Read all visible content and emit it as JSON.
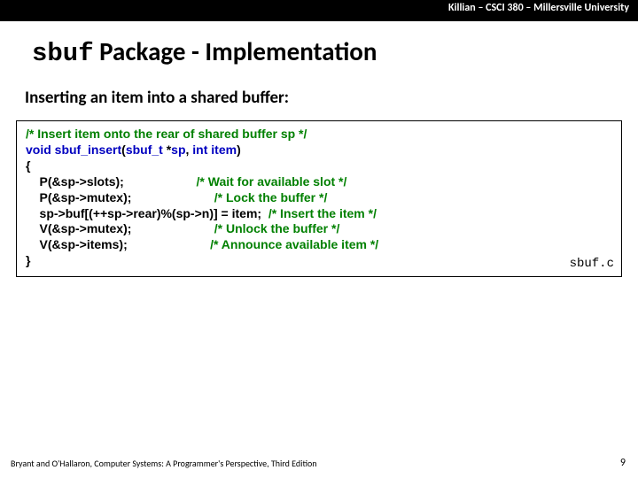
{
  "header": {
    "text": "Killian – CSCI 380 – Millersville University"
  },
  "title": {
    "mono": "sbuf",
    "rest": " Package - Implementation"
  },
  "subhead": "Inserting an item into a shared buffer:",
  "code": {
    "l01_comment": "/* Insert item onto the rear of shared buffer sp */",
    "l02_kw_void": "void",
    "l02_name": " sbuf_insert",
    "l02_paren_open": "(",
    "l02_type": "sbuf_t",
    "l02_star_sp": " *",
    "l02_var_sp": "sp",
    "l02_comma": ", ",
    "l02_kw_int": "int",
    "l02_sp": " ",
    "l02_var_item": "item",
    "l02_paren_close": ")",
    "l03_brace": "{",
    "l04_code": "    P(&sp->slots);                     ",
    "l04_comment": "/* Wait for available slot */",
    "l05_code": "    P(&sp->mutex);                        ",
    "l05_comment": "/* Lock the buffer */",
    "l06_code": "    sp->buf[(++sp->rear)%(sp->n)] = item;  ",
    "l06_comment": "/* Insert the item */",
    "l07_code": "    V(&sp->mutex);                        ",
    "l07_comment": "/* Unlock the buffer */",
    "l08_code": "    V(&sp->items);                        ",
    "l08_comment": "/* Announce available item */",
    "l09_brace": "}",
    "label": "sbuf.c"
  },
  "footer": {
    "left": "Bryant and O'Hallaron, Computer Systems: A Programmer's Perspective, Third Edition",
    "right": "9"
  }
}
